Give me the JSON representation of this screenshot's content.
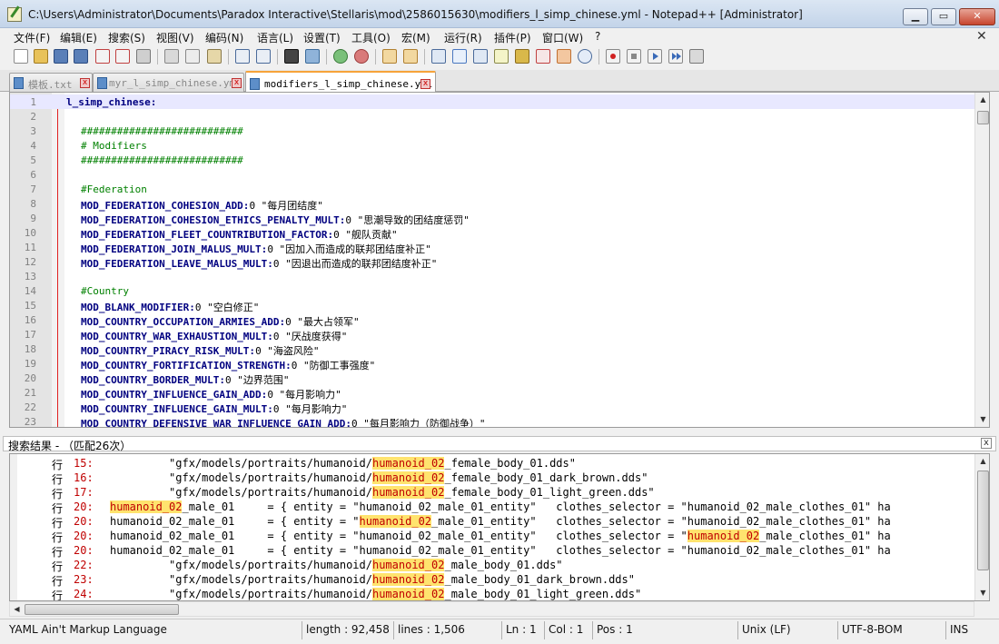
{
  "window": {
    "title": "C:\\Users\\Administrator\\Documents\\Paradox Interactive\\Stellaris\\mod\\2586015630\\modifiers_l_simp_chinese.yml - Notepad++ [Administrator]",
    "min_glyph": "▁",
    "max_glyph": "▭",
    "close_glyph": "✕"
  },
  "menu": {
    "items": [
      "文件(F)",
      "编辑(E)",
      "搜索(S)",
      "视图(V)",
      "编码(N)",
      "语言(L)",
      "设置(T)",
      "工具(O)",
      "宏(M)",
      "运行(R)",
      "插件(P)",
      "窗口(W)",
      "?"
    ],
    "close_glyph": "✕"
  },
  "toolbar": {
    "icons": [
      "new-file",
      "open-file",
      "save",
      "save-all",
      "close",
      "close-all",
      "print",
      "cut",
      "copy",
      "paste",
      "undo",
      "redo",
      "find",
      "replace",
      "zoom-in",
      "zoom-out",
      "sync-vertical",
      "sync-horizontal",
      "word-wrap",
      "show-all-chars",
      "indent-guide",
      "document-map",
      "function-list",
      "folder-as-workspace",
      "monitoring",
      "record-macro",
      "stop-record",
      "playback",
      "run-multiple",
      "save-macro"
    ]
  },
  "tabs": [
    {
      "label": "模板.txt",
      "close": "x",
      "active": false
    },
    {
      "label": "myr_l_simp_chinese.yml",
      "close": "x",
      "active": false
    },
    {
      "label": "modifiers_l_simp_chinese.yml",
      "close": "x",
      "active": true
    }
  ],
  "editor": {
    "lines": [
      {
        "n": "1",
        "key": "l_simp_chinese:",
        "val": "",
        "type": "root"
      },
      {
        "n": "2",
        "key": "",
        "val": "",
        "type": "blank"
      },
      {
        "n": "3",
        "key": "###########################",
        "val": "",
        "type": "comment"
      },
      {
        "n": "4",
        "key": "# Modifiers",
        "val": "",
        "type": "comment"
      },
      {
        "n": "5",
        "key": "###########################",
        "val": "",
        "type": "comment"
      },
      {
        "n": "6",
        "key": "",
        "val": "",
        "type": "blank"
      },
      {
        "n": "7",
        "key": "#Federation",
        "val": "",
        "type": "comment"
      },
      {
        "n": "8",
        "key": "MOD_FEDERATION_COHESION_ADD:",
        "val": "0 \"每月团结度\"",
        "type": "kv"
      },
      {
        "n": "9",
        "key": "MOD_FEDERATION_COHESION_ETHICS_PENALTY_MULT:",
        "val": "0 \"思潮导致的团结度惩罚\"",
        "type": "kv"
      },
      {
        "n": "10",
        "key": "MOD_FEDERATION_FLEET_COUNTRIBUTION_FACTOR:",
        "val": "0 \"舰队贡献\"",
        "type": "kv"
      },
      {
        "n": "11",
        "key": "MOD_FEDERATION_JOIN_MALUS_MULT:",
        "val": "0 \"因加入而造成的联邦团结度补正\"",
        "type": "kv"
      },
      {
        "n": "12",
        "key": "MOD_FEDERATION_LEAVE_MALUS_MULT:",
        "val": "0 \"因退出而造成的联邦团结度补正\"",
        "type": "kv"
      },
      {
        "n": "13",
        "key": "",
        "val": "",
        "type": "blank"
      },
      {
        "n": "14",
        "key": "#Country",
        "val": "",
        "type": "comment"
      },
      {
        "n": "15",
        "key": "MOD_BLANK_MODIFIER:",
        "val": "0 \"空白修正\"",
        "type": "kv"
      },
      {
        "n": "16",
        "key": "MOD_COUNTRY_OCCUPATION_ARMIES_ADD:",
        "val": "0 \"最大占领军\"",
        "type": "kv"
      },
      {
        "n": "17",
        "key": "MOD_COUNTRY_WAR_EXHAUSTION_MULT:",
        "val": "0 \"厌战度获得\"",
        "type": "kv"
      },
      {
        "n": "18",
        "key": "MOD_COUNTRY_PIRACY_RISK_MULT:",
        "val": "0 \"海盗风险\"",
        "type": "kv"
      },
      {
        "n": "19",
        "key": "MOD_COUNTRY_FORTIFICATION_STRENGTH:",
        "val": "0 \"防御工事强度\"",
        "type": "kv"
      },
      {
        "n": "20",
        "key": "MOD_COUNTRY_BORDER_MULT:",
        "val": "0 \"边界范围\"",
        "type": "kv"
      },
      {
        "n": "21",
        "key": "MOD_COUNTRY_INFLUENCE_GAIN_ADD:",
        "val": "0 \"每月影响力\"",
        "type": "kv"
      },
      {
        "n": "22",
        "key": "MOD_COUNTRY_INFLUENCE_GAIN_MULT:",
        "val": "0 \"每月影响力\"",
        "type": "kv"
      },
      {
        "n": "23",
        "key": "MOD_COUNTRY_DEFENSIVE_WAR_INFLUENCE_GAIN_ADD:",
        "val": "0 \"每月影响力（防御战争）\"",
        "type": "kv"
      }
    ]
  },
  "search_results": {
    "title": "搜索结果 - （匹配26次）",
    "close_glyph": "x",
    "rows": [
      {
        "prefix": "行",
        "num": "15:",
        "before": "         \"gfx/models/portraits/humanoid/",
        "match": "humanoid_02",
        "after": "_female_body_01.dds\""
      },
      {
        "prefix": "行",
        "num": "16:",
        "before": "         \"gfx/models/portraits/humanoid/",
        "match": "humanoid_02",
        "after": "_female_body_01_dark_brown.dds\""
      },
      {
        "prefix": "行",
        "num": "17:",
        "before": "         \"gfx/models/portraits/humanoid/",
        "match": "humanoid_02",
        "after": "_female_body_01_light_green.dds\""
      },
      {
        "prefix": "行",
        "num": "20:",
        "before": "",
        "match": "humanoid_02",
        "after": "_male_01     = { entity = \"humanoid_02_male_01_entity\"   clothes_selector = \"humanoid_02_male_clothes_01\" ha"
      },
      {
        "prefix": "行",
        "num": "20:",
        "before": "humanoid_02_male_01     = { entity = \"",
        "match": "humanoid_02",
        "after": "_male_01_entity\"   clothes_selector = \"humanoid_02_male_clothes_01\" ha"
      },
      {
        "prefix": "行",
        "num": "20:",
        "before": "humanoid_02_male_01     = { entity = \"humanoid_02_male_01_entity\"   clothes_selector = \"",
        "match": "humanoid_02",
        "after": "_male_clothes_01\" ha"
      },
      {
        "prefix": "行",
        "num": "20:",
        "before": "humanoid_02_male_01     = { entity = \"humanoid_02_male_01_entity\"   clothes_selector = \"humanoid_02_male_clothes_01\" ha",
        "match": "",
        "after": ""
      },
      {
        "prefix": "行",
        "num": "22:",
        "before": "         \"gfx/models/portraits/humanoid/",
        "match": "humanoid_02",
        "after": "_male_body_01.dds\""
      },
      {
        "prefix": "行",
        "num": "23:",
        "before": "         \"gfx/models/portraits/humanoid/",
        "match": "humanoid_02",
        "after": "_male_body_01_dark_brown.dds\""
      },
      {
        "prefix": "行",
        "num": "24:",
        "before": "         \"gfx/models/portraits/humanoid/",
        "match": "humanoid_02",
        "after": "_male_body_01_light_green.dds\""
      }
    ]
  },
  "status": {
    "language": "YAML Ain't Markup Language",
    "length": "length : 92,458",
    "lines": "lines : 1,506",
    "ln": "Ln : 1",
    "col": "Col : 1",
    "pos": "Pos : 1",
    "eol": "Unix (LF)",
    "encoding": "UTF-8-BOM",
    "mode": "INS"
  },
  "colors": {
    "key": "#000080",
    "comment": "#008000",
    "match_bg": "#ffe36e",
    "match_fg": "#c00000",
    "active_tab_accent": "#f7a33a"
  }
}
